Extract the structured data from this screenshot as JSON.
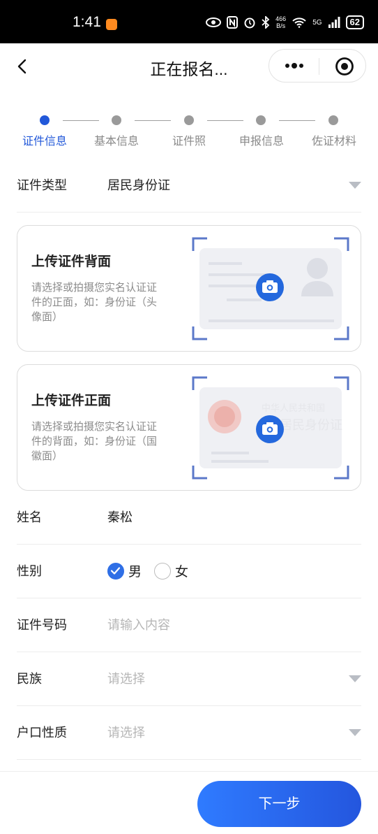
{
  "status_bar": {
    "time": "1:41",
    "net_speed_value": "466",
    "net_speed_unit": "B/s",
    "network": "5G",
    "battery": "62",
    "icons": [
      "eye-icon",
      "nfc-icon",
      "alarm-icon",
      "bluetooth-icon",
      "wifi-icon",
      "signal-icon",
      "battery-icon"
    ]
  },
  "nav": {
    "title": "正在报名...",
    "back_icon": "chevron-left-icon",
    "more_icon": "more-dots-icon",
    "close_icon": "target-circle-icon"
  },
  "steps": [
    {
      "label": "证件信息",
      "active": true
    },
    {
      "label": "基本信息",
      "active": false
    },
    {
      "label": "证件照",
      "active": false
    },
    {
      "label": "申报信息",
      "active": false
    },
    {
      "label": "佐证材料",
      "active": false
    }
  ],
  "form": {
    "id_type": {
      "label": "证件类型",
      "value": "居民身份证"
    },
    "upload_back": {
      "title": "上传证件背面",
      "desc": "请选择或拍摄您实名认证证件的正面，如：身份证（头像面）"
    },
    "upload_front": {
      "title": "上传证件正面",
      "desc": "请选择或拍摄您实名认证证件的背面，如：身份证（国徽面）",
      "card_text_1": "中华人民共和国",
      "card_text_2": "居民身份证"
    },
    "name": {
      "label": "姓名",
      "value": "秦松"
    },
    "gender": {
      "label": "性别",
      "options": [
        "男",
        "女"
      ],
      "selected": "男"
    },
    "id_number": {
      "label": "证件号码",
      "placeholder": "请输入内容"
    },
    "ethnicity": {
      "label": "民族",
      "placeholder": "请选择"
    },
    "household": {
      "label": "户口性质",
      "placeholder": "请选择"
    }
  },
  "footer": {
    "next_label": "下一步"
  },
  "colors": {
    "primary": "#2258d9",
    "button_start": "#2f7bff",
    "button_end": "#2456de"
  }
}
